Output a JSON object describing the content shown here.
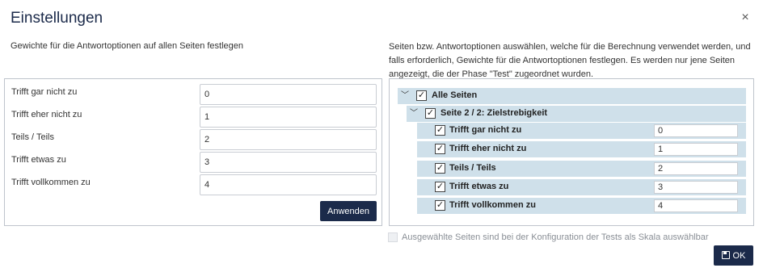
{
  "dialog": {
    "title": "Einstellungen",
    "close_glyph": "×",
    "ok_label": "OK"
  },
  "left": {
    "description": "Gewichte für die Antwortoptionen auf allen Seiten festlegen",
    "options": [
      {
        "label": "Trifft gar nicht zu",
        "value": "0"
      },
      {
        "label": "Trifft eher nicht zu",
        "value": "1"
      },
      {
        "label": "Teils / Teils",
        "value": "2"
      },
      {
        "label": "Trifft etwas zu",
        "value": "3"
      },
      {
        "label": "Trifft vollkommen zu",
        "value": "4"
      }
    ],
    "apply_label": "Anwenden"
  },
  "right": {
    "description": "Seiten bzw. Antwortoptionen auswählen, welche für die Berechnung verwendet werden, und falls erforderlich, Gewichte für die Antwortoptionen festlegen. Es werden nur jene Seiten angezeigt, die der Phase \"Test\" zugeordnet wurden.",
    "tree": {
      "root_label": "Alle Seiten",
      "page_label": "Seite 2 / 2: Zielstrebigkeit",
      "options": [
        {
          "label": "Trifft gar nicht zu",
          "value": "0"
        },
        {
          "label": "Trifft eher nicht zu",
          "value": "1"
        },
        {
          "label": "Teils / Teils",
          "value": "2"
        },
        {
          "label": "Trifft etwas zu",
          "value": "3"
        },
        {
          "label": "Trifft vollkommen zu",
          "value": "4"
        }
      ]
    }
  },
  "footer": {
    "checkbox_label": "Ausgewählte Seiten sind bei der Konfiguration der Tests als Skala auswählbar"
  },
  "icons": {
    "check": "✓",
    "chevron_down": "﹀"
  },
  "colors": {
    "primary": "#1b2a4a",
    "tree_row_bg": "#cfe0ea"
  }
}
